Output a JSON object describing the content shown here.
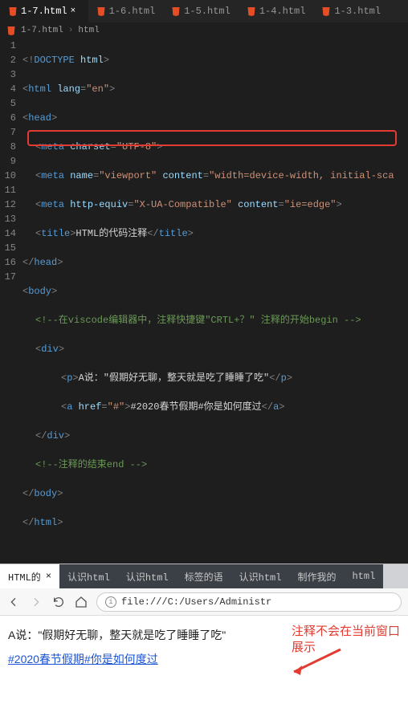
{
  "editor": {
    "tabs": [
      {
        "label": "1-7.html",
        "active": true
      },
      {
        "label": "1-6.html",
        "active": false
      },
      {
        "label": "1-5.html",
        "active": false
      },
      {
        "label": "1-4.html",
        "active": false
      },
      {
        "label": "1-3.html",
        "active": false
      }
    ],
    "breadcrumb": {
      "file": "1-7.html",
      "node": "html"
    },
    "lines": {
      "l1_doctype": "DOCTYPE",
      "l1_doctype_val": "html",
      "l2_tag": "html",
      "l2_attr": "lang",
      "l2_val": "\"en\"",
      "l3_tag": "head",
      "l4_tag": "meta",
      "l4_a1": "charset",
      "l4_v1": "\"UTF-8\"",
      "l5_tag": "meta",
      "l5_a1": "name",
      "l5_v1": "\"viewport\"",
      "l5_a2": "content",
      "l5_v2": "\"width=device-width, initial-sca",
      "l6_tag": "meta",
      "l6_a1": "http-equiv",
      "l6_v1": "\"X-UA-Compatible\"",
      "l6_a2": "content",
      "l6_v2": "\"ie=edge\"",
      "l7_tag": "title",
      "l7_txt": "HTML的代码注释",
      "l8_tag": "head",
      "l9_tag": "body",
      "l10_cmt": "<!--在viscode编辑器中，注释快捷键\"CRTL+？\" 注释的开始begin -->",
      "l11_tag": "div",
      "l12_tag": "p",
      "l12_txt": "A说：\"假期好无聊，整天就是吃了睡睡了吃\"",
      "l13_tag": "a",
      "l13_a1": "href",
      "l13_v1": "\"#\"",
      "l13_txt": "#2020春节假期#你是如何度过",
      "l14_tag": "div",
      "l15_cmt": "<!--注释的结束end -->",
      "l16_tag": "body",
      "l17_tag": "html"
    },
    "line_numbers": [
      "1",
      "2",
      "3",
      "4",
      "5",
      "6",
      "7",
      "8",
      "9",
      "10",
      "11",
      "12",
      "13",
      "14",
      "15",
      "16",
      "17"
    ]
  },
  "browser": {
    "tabs": [
      {
        "label": "HTML的",
        "active": true
      },
      {
        "label": "认识html",
        "active": false
      },
      {
        "label": "认识html",
        "active": false
      },
      {
        "label": "标签的语",
        "active": false
      },
      {
        "label": "认识html",
        "active": false
      },
      {
        "label": "制作我的",
        "active": false
      },
      {
        "label": "html",
        "active": false
      }
    ],
    "url": "file:///C:/Users/Administr",
    "page_text": "A说：\"假期好无聊，整天就是吃了睡睡了吃\"",
    "page_link": "#2020春节假期#你是如何度过",
    "annotation_l1": "注释不会在当前窗口",
    "annotation_l2": "展示"
  }
}
